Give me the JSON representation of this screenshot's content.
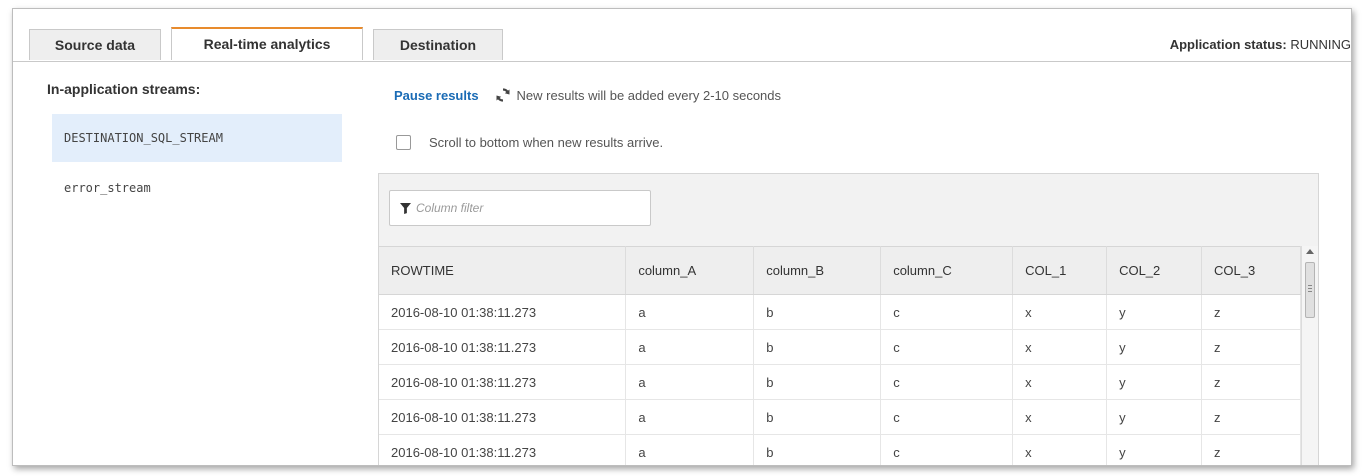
{
  "tabs": [
    {
      "label": "Source data"
    },
    {
      "label": "Real-time analytics"
    },
    {
      "label": "Destination"
    }
  ],
  "status": {
    "label": "Application status:",
    "value": "RUNNING"
  },
  "streams": {
    "title": "In-application streams:",
    "items": [
      {
        "label": "DESTINATION_SQL_STREAM"
      },
      {
        "label": "error_stream"
      }
    ]
  },
  "results": {
    "pause_label": "Pause results",
    "refresh_text": "New results will be added every 2-10 seconds",
    "scroll_label": "Scroll to bottom when new results arrive."
  },
  "filter": {
    "placeholder": "Column filter"
  },
  "table": {
    "columns": [
      "ROWTIME",
      "column_A",
      "column_B",
      "column_C",
      "COL_1",
      "COL_2",
      "COL_3"
    ],
    "rows": [
      [
        "2016-08-10 01:38:11.273",
        "a",
        "b",
        "c",
        "x",
        "y",
        "z"
      ],
      [
        "2016-08-10 01:38:11.273",
        "a",
        "b",
        "c",
        "x",
        "y",
        "z"
      ],
      [
        "2016-08-10 01:38:11.273",
        "a",
        "b",
        "c",
        "x",
        "y",
        "z"
      ],
      [
        "2016-08-10 01:38:11.273",
        "a",
        "b",
        "c",
        "x",
        "y",
        "z"
      ],
      [
        "2016-08-10 01:38:11.273",
        "a",
        "b",
        "c",
        "x",
        "y",
        "z"
      ]
    ]
  },
  "colors": {
    "accent_tab": "#e88b2d",
    "link": "#1a6bb5",
    "selected_stream": "#e3eefb"
  }
}
